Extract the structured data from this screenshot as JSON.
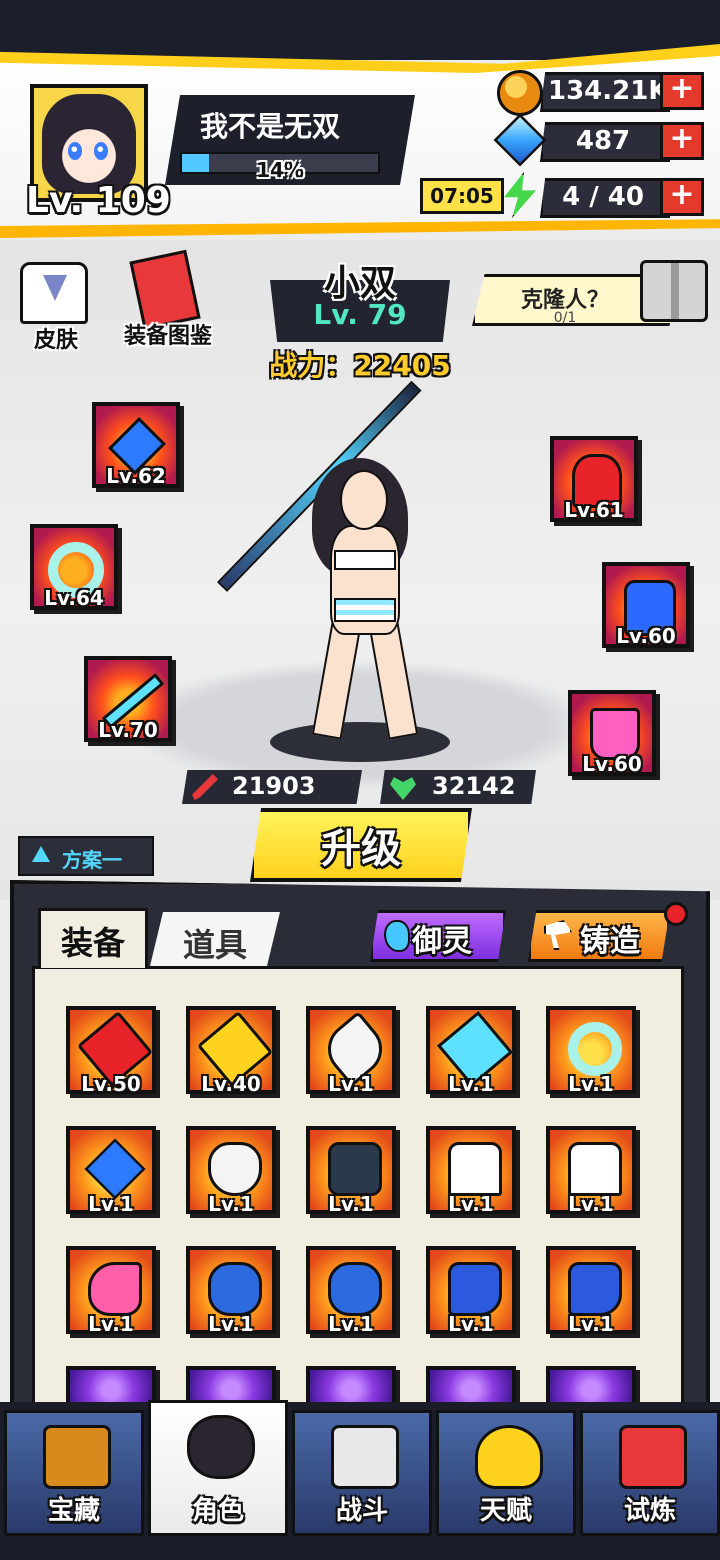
{
  "player": {
    "name": "我不是无双",
    "level": "Lv. 109",
    "exp_percent_label": "14%",
    "exp_fraction": 0.14
  },
  "resources": {
    "gold": "134.21K",
    "gems": "487",
    "energy": "4 / 40",
    "energy_timer": "07:05",
    "plus": "+"
  },
  "side_buttons": {
    "skin": "皮肤",
    "codex": "装备图鉴"
  },
  "character": {
    "name": "小双",
    "level": "Lv. 79",
    "power": "战力：22405",
    "attack": "21903",
    "hp": "32142"
  },
  "clone": {
    "label": "克隆人？",
    "count": "0/1"
  },
  "equipped": [
    {
      "slot": "necklace",
      "level": "Lv.62"
    },
    {
      "slot": "ring",
      "level": "Lv.64"
    },
    {
      "slot": "weapon",
      "level": "Lv.70"
    },
    {
      "slot": "gloves",
      "level": "Lv.61"
    },
    {
      "slot": "armor",
      "level": "Lv.60"
    },
    {
      "slot": "boots",
      "level": "Lv.60"
    }
  ],
  "actions": {
    "upgrade": "升级",
    "scheme": "方案一"
  },
  "panel": {
    "tab_equipment": "装备",
    "tab_items": "道具",
    "spirit": "御灵",
    "forge": "铸造"
  },
  "inventory": [
    {
      "level": "Lv.50",
      "item": "red-sword"
    },
    {
      "level": "Lv.40",
      "item": "yellow-sword"
    },
    {
      "level": "Lv.1",
      "item": "white-blade"
    },
    {
      "level": "Lv.1",
      "item": "jagged-blade"
    },
    {
      "level": "Lv.1",
      "item": "jade-ring"
    },
    {
      "level": "Lv.1",
      "item": "blue-necklace"
    },
    {
      "level": "Lv.1",
      "item": "white-mask"
    },
    {
      "level": "Lv.1",
      "item": "dark-armor"
    },
    {
      "level": "Lv.1",
      "item": "sailor-top"
    },
    {
      "level": "Lv.1",
      "item": "sailor-top"
    },
    {
      "level": "Lv.1",
      "item": "pink-shoe"
    },
    {
      "level": "Lv.1",
      "item": "blue-slipper"
    },
    {
      "level": "Lv.1",
      "item": "blue-slipper"
    },
    {
      "level": "Lv.1",
      "item": "blue-boot"
    },
    {
      "level": "Lv.1",
      "item": "blue-boot"
    }
  ],
  "nav": [
    {
      "label": "宝藏",
      "icon": "treasure-chest-icon"
    },
    {
      "label": "角色",
      "icon": "character-portrait-icon"
    },
    {
      "label": "战斗",
      "icon": "crossed-swords-icon"
    },
    {
      "label": "天赋",
      "icon": "lightbulb-icon"
    },
    {
      "label": "试炼",
      "icon": "trial-badge-icon"
    }
  ],
  "colors": {
    "accent_yellow": "#ffd21e",
    "panel_dark": "#2a2c38",
    "plus_red": "#e33a2c",
    "stat_teal": "#52e6c4"
  }
}
